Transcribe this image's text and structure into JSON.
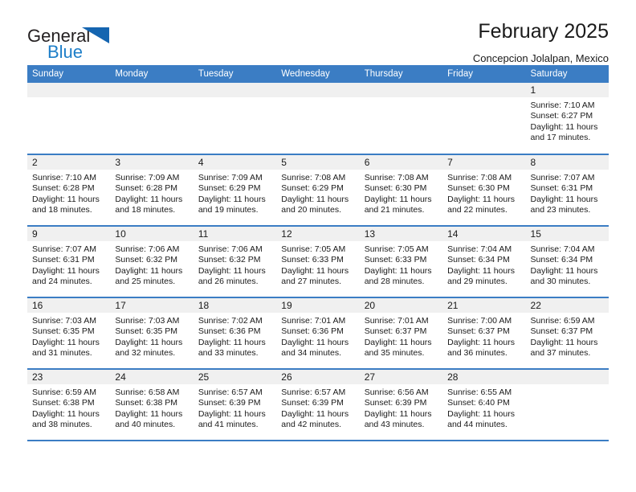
{
  "brand": {
    "name_part1": "General",
    "name_part2": "Blue",
    "logo_icon": "triangle-logo-icon"
  },
  "header": {
    "title": "February 2025",
    "subtitle": "Concepcion Jolalpan, Mexico"
  },
  "calendar": {
    "weekday_headers": [
      "Sunday",
      "Monday",
      "Tuesday",
      "Wednesday",
      "Thursday",
      "Friday",
      "Saturday"
    ],
    "accent_color": "#3b7dc4",
    "daynum_band_color": "#f0f0f0",
    "weeks": [
      [
        {
          "day": "",
          "sunrise": "",
          "sunset": "",
          "daylight": ""
        },
        {
          "day": "",
          "sunrise": "",
          "sunset": "",
          "daylight": ""
        },
        {
          "day": "",
          "sunrise": "",
          "sunset": "",
          "daylight": ""
        },
        {
          "day": "",
          "sunrise": "",
          "sunset": "",
          "daylight": ""
        },
        {
          "day": "",
          "sunrise": "",
          "sunset": "",
          "daylight": ""
        },
        {
          "day": "",
          "sunrise": "",
          "sunset": "",
          "daylight": ""
        },
        {
          "day": "1",
          "sunrise": "Sunrise: 7:10 AM",
          "sunset": "Sunset: 6:27 PM",
          "daylight": "Daylight: 11 hours and 17 minutes."
        }
      ],
      [
        {
          "day": "2",
          "sunrise": "Sunrise: 7:10 AM",
          "sunset": "Sunset: 6:28 PM",
          "daylight": "Daylight: 11 hours and 18 minutes."
        },
        {
          "day": "3",
          "sunrise": "Sunrise: 7:09 AM",
          "sunset": "Sunset: 6:28 PM",
          "daylight": "Daylight: 11 hours and 18 minutes."
        },
        {
          "day": "4",
          "sunrise": "Sunrise: 7:09 AM",
          "sunset": "Sunset: 6:29 PM",
          "daylight": "Daylight: 11 hours and 19 minutes."
        },
        {
          "day": "5",
          "sunrise": "Sunrise: 7:08 AM",
          "sunset": "Sunset: 6:29 PM",
          "daylight": "Daylight: 11 hours and 20 minutes."
        },
        {
          "day": "6",
          "sunrise": "Sunrise: 7:08 AM",
          "sunset": "Sunset: 6:30 PM",
          "daylight": "Daylight: 11 hours and 21 minutes."
        },
        {
          "day": "7",
          "sunrise": "Sunrise: 7:08 AM",
          "sunset": "Sunset: 6:30 PM",
          "daylight": "Daylight: 11 hours and 22 minutes."
        },
        {
          "day": "8",
          "sunrise": "Sunrise: 7:07 AM",
          "sunset": "Sunset: 6:31 PM",
          "daylight": "Daylight: 11 hours and 23 minutes."
        }
      ],
      [
        {
          "day": "9",
          "sunrise": "Sunrise: 7:07 AM",
          "sunset": "Sunset: 6:31 PM",
          "daylight": "Daylight: 11 hours and 24 minutes."
        },
        {
          "day": "10",
          "sunrise": "Sunrise: 7:06 AM",
          "sunset": "Sunset: 6:32 PM",
          "daylight": "Daylight: 11 hours and 25 minutes."
        },
        {
          "day": "11",
          "sunrise": "Sunrise: 7:06 AM",
          "sunset": "Sunset: 6:32 PM",
          "daylight": "Daylight: 11 hours and 26 minutes."
        },
        {
          "day": "12",
          "sunrise": "Sunrise: 7:05 AM",
          "sunset": "Sunset: 6:33 PM",
          "daylight": "Daylight: 11 hours and 27 minutes."
        },
        {
          "day": "13",
          "sunrise": "Sunrise: 7:05 AM",
          "sunset": "Sunset: 6:33 PM",
          "daylight": "Daylight: 11 hours and 28 minutes."
        },
        {
          "day": "14",
          "sunrise": "Sunrise: 7:04 AM",
          "sunset": "Sunset: 6:34 PM",
          "daylight": "Daylight: 11 hours and 29 minutes."
        },
        {
          "day": "15",
          "sunrise": "Sunrise: 7:04 AM",
          "sunset": "Sunset: 6:34 PM",
          "daylight": "Daylight: 11 hours and 30 minutes."
        }
      ],
      [
        {
          "day": "16",
          "sunrise": "Sunrise: 7:03 AM",
          "sunset": "Sunset: 6:35 PM",
          "daylight": "Daylight: 11 hours and 31 minutes."
        },
        {
          "day": "17",
          "sunrise": "Sunrise: 7:03 AM",
          "sunset": "Sunset: 6:35 PM",
          "daylight": "Daylight: 11 hours and 32 minutes."
        },
        {
          "day": "18",
          "sunrise": "Sunrise: 7:02 AM",
          "sunset": "Sunset: 6:36 PM",
          "daylight": "Daylight: 11 hours and 33 minutes."
        },
        {
          "day": "19",
          "sunrise": "Sunrise: 7:01 AM",
          "sunset": "Sunset: 6:36 PM",
          "daylight": "Daylight: 11 hours and 34 minutes."
        },
        {
          "day": "20",
          "sunrise": "Sunrise: 7:01 AM",
          "sunset": "Sunset: 6:37 PM",
          "daylight": "Daylight: 11 hours and 35 minutes."
        },
        {
          "day": "21",
          "sunrise": "Sunrise: 7:00 AM",
          "sunset": "Sunset: 6:37 PM",
          "daylight": "Daylight: 11 hours and 36 minutes."
        },
        {
          "day": "22",
          "sunrise": "Sunrise: 6:59 AM",
          "sunset": "Sunset: 6:37 PM",
          "daylight": "Daylight: 11 hours and 37 minutes."
        }
      ],
      [
        {
          "day": "23",
          "sunrise": "Sunrise: 6:59 AM",
          "sunset": "Sunset: 6:38 PM",
          "daylight": "Daylight: 11 hours and 38 minutes."
        },
        {
          "day": "24",
          "sunrise": "Sunrise: 6:58 AM",
          "sunset": "Sunset: 6:38 PM",
          "daylight": "Daylight: 11 hours and 40 minutes."
        },
        {
          "day": "25",
          "sunrise": "Sunrise: 6:57 AM",
          "sunset": "Sunset: 6:39 PM",
          "daylight": "Daylight: 11 hours and 41 minutes."
        },
        {
          "day": "26",
          "sunrise": "Sunrise: 6:57 AM",
          "sunset": "Sunset: 6:39 PM",
          "daylight": "Daylight: 11 hours and 42 minutes."
        },
        {
          "day": "27",
          "sunrise": "Sunrise: 6:56 AM",
          "sunset": "Sunset: 6:39 PM",
          "daylight": "Daylight: 11 hours and 43 minutes."
        },
        {
          "day": "28",
          "sunrise": "Sunrise: 6:55 AM",
          "sunset": "Sunset: 6:40 PM",
          "daylight": "Daylight: 11 hours and 44 minutes."
        },
        {
          "day": "",
          "sunrise": "",
          "sunset": "",
          "daylight": ""
        }
      ]
    ]
  }
}
